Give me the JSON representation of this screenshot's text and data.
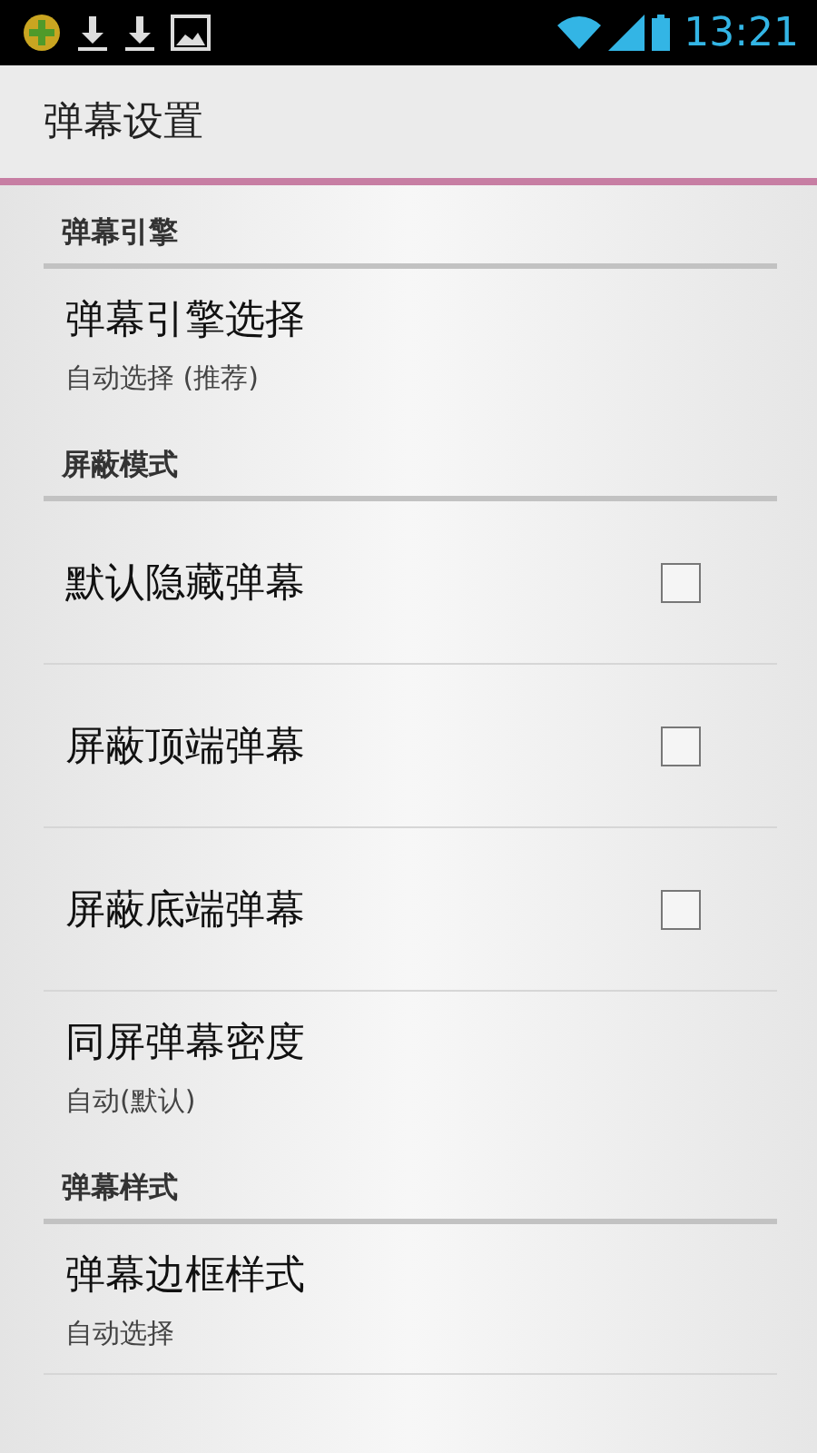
{
  "status_bar": {
    "time": "13:21"
  },
  "title": "弹幕设置",
  "sections": [
    {
      "header": "弹幕引擎",
      "items": [
        {
          "kind": "summary",
          "title": "弹幕引擎选择",
          "summary": "自动选择 (推荐)"
        }
      ]
    },
    {
      "header": "屏蔽模式",
      "items": [
        {
          "kind": "checkbox",
          "title": "默认隐藏弹幕",
          "checked": false
        },
        {
          "kind": "checkbox",
          "title": "屏蔽顶端弹幕",
          "checked": false
        },
        {
          "kind": "checkbox",
          "title": "屏蔽底端弹幕",
          "checked": false
        },
        {
          "kind": "summary",
          "title": "同屏弹幕密度",
          "summary": "自动(默认)"
        }
      ]
    },
    {
      "header": "弹幕样式",
      "items": [
        {
          "kind": "summary",
          "title": "弹幕边框样式",
          "summary": "自动选择"
        }
      ]
    }
  ]
}
